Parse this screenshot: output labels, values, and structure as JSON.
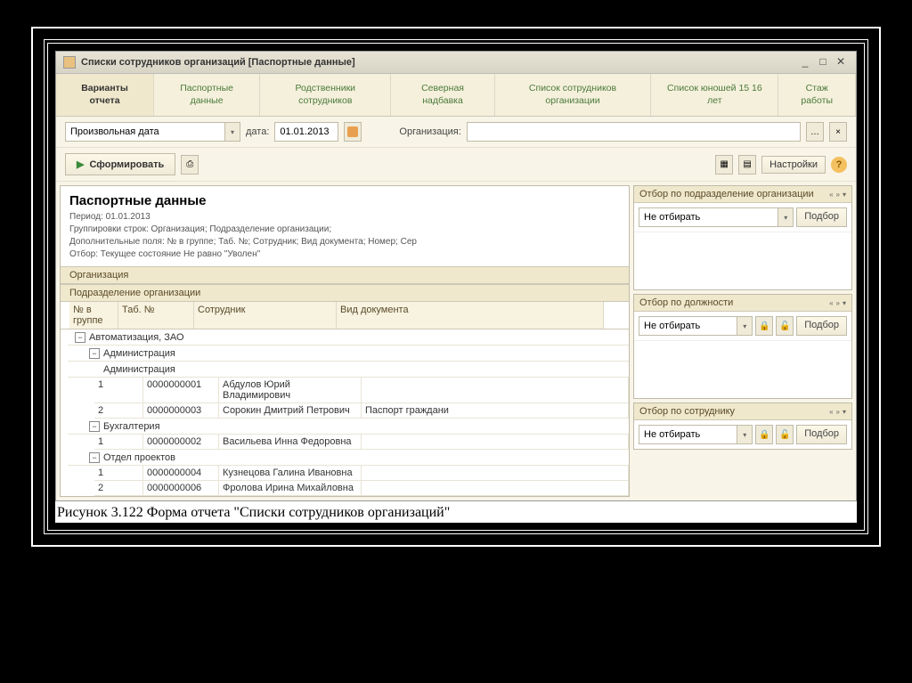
{
  "window": {
    "title": "Списки сотрудников организаций [Паспортные данные]"
  },
  "tabs": [
    {
      "label": "Варианты отчета",
      "active": true
    },
    {
      "label": "Паспортные данные"
    },
    {
      "label": "Родственники сотрудников"
    },
    {
      "label": "Северная надбавка"
    },
    {
      "label": "Список сотрудников организации"
    },
    {
      "label": "Список юношей 15 16 лет"
    },
    {
      "label": "Стаж работы"
    }
  ],
  "toolbar": {
    "mode_value": "Произвольная дата",
    "date_label": "дата:",
    "date_value": "01.01.2013",
    "org_label": "Организация:",
    "org_value": "",
    "form_label": "Сформировать",
    "settings_label": "Настройки"
  },
  "report": {
    "title": "Паспортные данные",
    "period": "Период: 01.01.2013",
    "group_line": "Группировки строк: Организация; Подразделение организации;",
    "extra_line": "Дополнительные поля: № в группе; Таб. №; Сотрудник; Вид документа; Номер; Сер",
    "filter_line": "Отбор: Текущее состояние Не равно \"Уволен\"",
    "group_header1": "Организация",
    "group_header2": "Подразделение организации",
    "columns": {
      "c1": "№ в группе",
      "c2": "Таб. №",
      "c3": "Сотрудник",
      "c4": "Вид документа"
    },
    "data": {
      "org": "Автоматизация, ЗАО",
      "admin": "Администрация",
      "admin2": "Администрация",
      "r1": {
        "n": "1",
        "tab": "0000000001",
        "name": "Абдулов Юрий Владимирович",
        "doc": ""
      },
      "r2": {
        "n": "2",
        "tab": "0000000003",
        "name": "Сорокин Дмитрий Петрович",
        "doc": "Паспорт граждани"
      },
      "buh": "Бухгалтерия",
      "r3": {
        "n": "1",
        "tab": "0000000002",
        "name": "Васильева Инна Федоровна",
        "doc": ""
      },
      "proj": "Отдел проектов",
      "r4": {
        "n": "1",
        "tab": "0000000004",
        "name": "Кузнецова Галина Ивановна",
        "doc": ""
      },
      "r5": {
        "n": "2",
        "tab": "0000000006",
        "name": "Фролова Ирина Михайловна",
        "doc": ""
      }
    }
  },
  "filters": {
    "f1": {
      "title": "Отбор по подразделение организации",
      "mode": "Не отбирать",
      "btn": "Подбор"
    },
    "f2": {
      "title": "Отбор по должности",
      "mode": "Не отбирать",
      "btn": "Подбор"
    },
    "f3": {
      "title": "Отбор по сотруднику",
      "mode": "Не отбирать",
      "btn": "Подбор"
    }
  },
  "caption": "Рисунок 3.122 Форма отчета \"Списки сотрудников организаций\""
}
